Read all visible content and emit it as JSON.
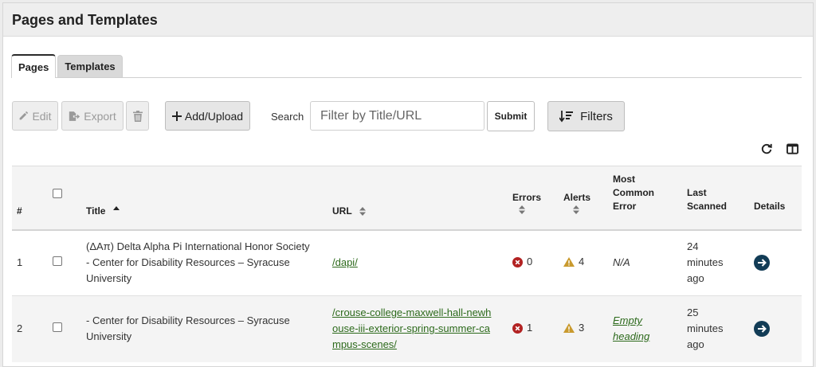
{
  "header": {
    "title": "Pages and Templates"
  },
  "tabs": [
    {
      "label": "Pages",
      "active": true
    },
    {
      "label": "Templates",
      "active": false
    }
  ],
  "toolbar": {
    "edit_label": "Edit",
    "export_label": "Export",
    "add_label": "Add/Upload",
    "search_label": "Search",
    "search_placeholder": "Filter by Title/URL",
    "submit_label": "Submit",
    "filters_label": "Filters"
  },
  "table": {
    "columns": {
      "num": "#",
      "title": "Title",
      "url": "URL",
      "errors": "Errors",
      "alerts": "Alerts",
      "most_common_1": "Most",
      "most_common_2": "Common",
      "most_common_3": "Error",
      "last_1": "Last",
      "last_2": "Scanned",
      "details": "Details"
    },
    "rows": [
      {
        "num": "1",
        "title_1": "(ΔΑπ) Delta Alpha Pi International Honor Society",
        "title_2": "- Center for Disability Resources – Syracuse",
        "title_3": "University",
        "url_1": "/dapi/",
        "url_2": "",
        "url_3": "",
        "errors": "0",
        "alerts": "4",
        "most_common_1": "N/A",
        "most_common_2": "",
        "last_1": "24",
        "last_2": "minutes",
        "last_3": "ago"
      },
      {
        "num": "2",
        "title_1": "- Center for Disability Resources – Syracuse",
        "title_2": "University",
        "title_3": "",
        "url_1": "/crouse-college-maxwell-hall-newh",
        "url_2": "ouse-iii-exterior-spring-summer-ca",
        "url_3": "mpus-scenes/",
        "errors": "1",
        "alerts": "3",
        "most_common_1": "Empty",
        "most_common_2": "heading",
        "last_1": "25",
        "last_2": "minutes",
        "last_3": "ago"
      }
    ]
  },
  "colors": {
    "error": "#b22222",
    "alert": "#c99a2e",
    "link": "#2d6a1c",
    "details": "#123c56"
  }
}
